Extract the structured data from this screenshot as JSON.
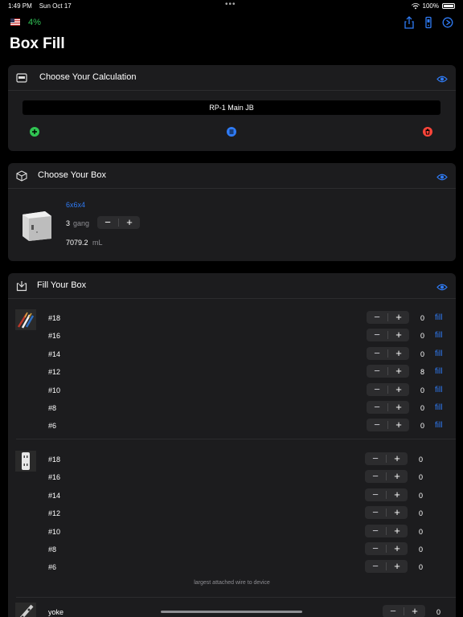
{
  "status_bar": {
    "time": "1:49 PM",
    "date": "Sun Oct 17",
    "battery": "100%"
  },
  "toolbar": {
    "percent": "4%",
    "icons": [
      "share-icon",
      "device-icon",
      "play-circle-icon"
    ]
  },
  "page": {
    "title": "Box Fill"
  },
  "calculation": {
    "header": "Choose Your Calculation",
    "selected": "RP-1 Main JB",
    "colors": {
      "add": "#30c452",
      "list": "#2f7bf5",
      "delete": "#ff453a"
    }
  },
  "box": {
    "header": "Choose Your Box",
    "name": "6x6x4",
    "gang_count": "3",
    "gang_label": "gang",
    "volume": "7079.2",
    "volume_unit": "mL"
  },
  "fill": {
    "header": "Fill Your Box",
    "fill_label": "fill",
    "conductors": [
      {
        "gauge": "#18",
        "count": "0"
      },
      {
        "gauge": "#16",
        "count": "0"
      },
      {
        "gauge": "#14",
        "count": "0"
      },
      {
        "gauge": "#12",
        "count": "8"
      },
      {
        "gauge": "#10",
        "count": "0"
      },
      {
        "gauge": "#8",
        "count": "0"
      },
      {
        "gauge": "#6",
        "count": "0"
      }
    ],
    "devices": [
      {
        "gauge": "#18",
        "count": "0"
      },
      {
        "gauge": "#16",
        "count": "0"
      },
      {
        "gauge": "#14",
        "count": "0"
      },
      {
        "gauge": "#12",
        "count": "0"
      },
      {
        "gauge": "#10",
        "count": "0"
      },
      {
        "gauge": "#8",
        "count": "0"
      },
      {
        "gauge": "#6",
        "count": "0"
      }
    ],
    "device_note": "largest attached wire to device",
    "yoke": {
      "label": "yoke",
      "count": "0"
    }
  },
  "stepper": {
    "minus": "−",
    "plus": "+"
  },
  "accent": "#2f7bf5"
}
